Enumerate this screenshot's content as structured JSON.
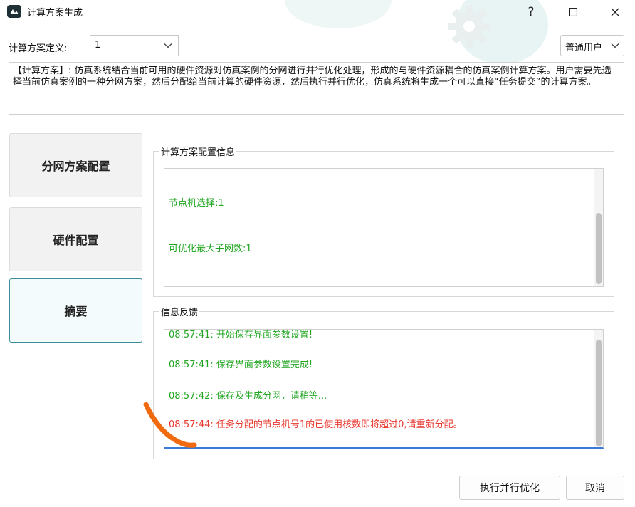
{
  "window": {
    "title": "计算方案生成",
    "help_label": "?"
  },
  "header": {
    "definition_label": "计算方案定义:",
    "definition_value": "1",
    "user_mode": "普通用户"
  },
  "description": "【计算方案】: 仿真系统结合当前可用的硬件资源对仿真案例的分网进行并行优化处理，形成的与硬件资源耦合的仿真案例计算方案。用户需要先选择当前仿真案例的一种分网方案，然后分配给当前计算的硬件资源，然后执行并行优化，仿真系统将生成一个可以直接“任务提交”的计算方案。",
  "nav": {
    "items": [
      {
        "label": "分网方案配置"
      },
      {
        "label": "硬件配置"
      },
      {
        "label": "摘要",
        "active": true
      }
    ]
  },
  "config_info": {
    "title": "计算方案配置信息",
    "lines": [
      "节点机选择:1",
      "可优化最大子网数:1"
    ]
  },
  "feedback": {
    "title": "信息反馈",
    "lines": [
      "08:57:41: 开始保存界面参数设置!",
      "08:57:41: 保存界面参数设置完成!",
      "08:57:42: 保存及生成分网，请稍等...",
      "08:57:44: 任务分配的节点机号1的已使用核数即将超过0,请重新分配。"
    ]
  },
  "buttons": {
    "execute": "执行并行优化",
    "cancel": "取消"
  },
  "colors": {
    "success_text": "#22a622",
    "error_text": "#e8382f",
    "active_border": "#3c8c9c",
    "annotation": "#f26a0f"
  },
  "icons": [
    "app-icon",
    "help-icon",
    "maximize-icon",
    "close-icon",
    "chevron-down-icon",
    "gear-icon"
  ]
}
